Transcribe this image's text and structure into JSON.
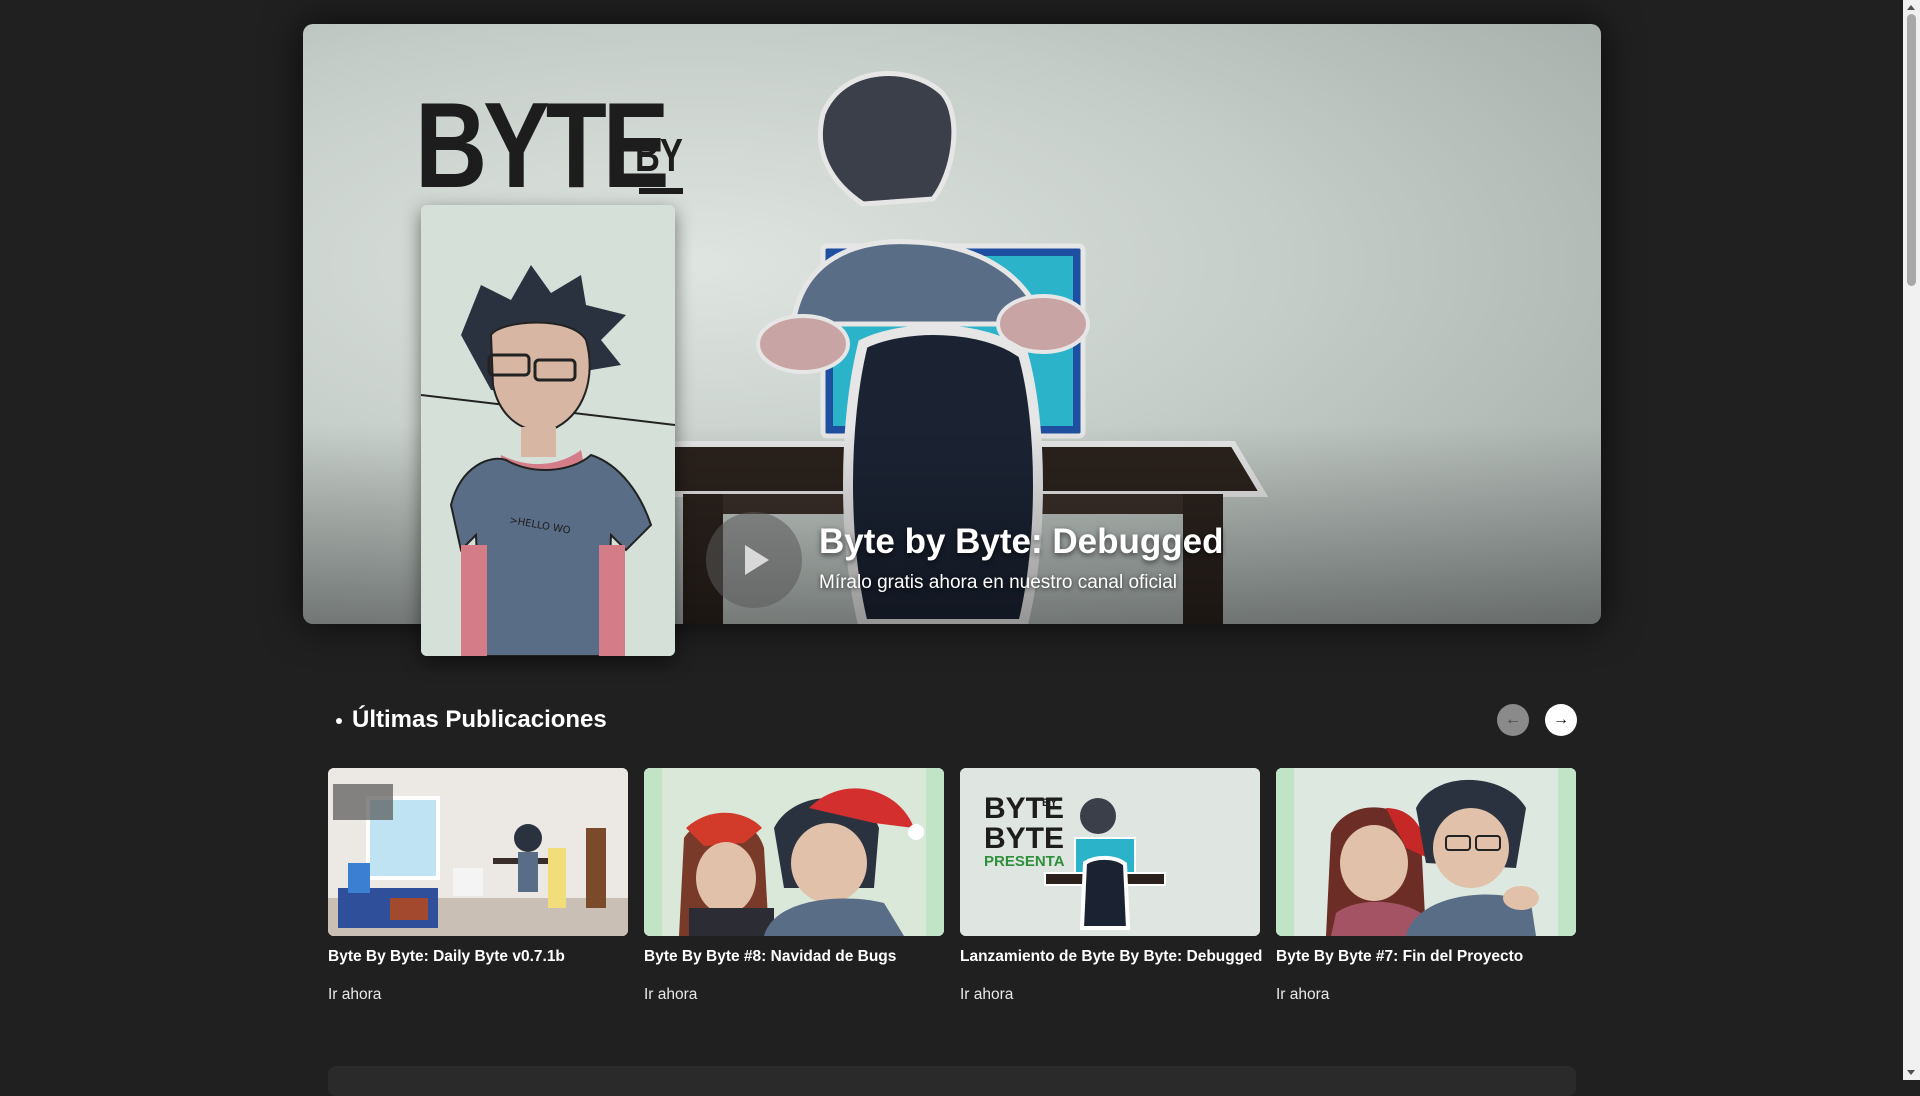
{
  "hero": {
    "logo_main": "BYTE",
    "logo_by": "BY",
    "title": "Byte by Byte: Debugged",
    "subtitle": "Míralo gratis ahora en nuestro canal oficial",
    "play_icon": "play-icon"
  },
  "latest": {
    "heading": "Últimas Publicaciones",
    "prev_icon": "arrow-left-icon",
    "next_icon": "arrow-right-icon",
    "cards": [
      {
        "title": "Byte By Byte: Daily Byte v0.7.1b",
        "link": "Ir ahora"
      },
      {
        "title": "Byte By Byte #8: Navidad de Bugs",
        "link": "Ir ahora"
      },
      {
        "title": "Lanzamiento de Byte By Byte: Debugged",
        "link": "Ir ahora",
        "thumb_logo_1": "BYTE",
        "thumb_logo_2": "BYTE",
        "thumb_by": "BY",
        "thumb_presenta": "PRESENTA"
      },
      {
        "title": "Byte By Byte #7: Fin del Proyecto",
        "link": "Ir ahora"
      }
    ]
  },
  "colors": {
    "background": "#202020",
    "text": "#ffffff",
    "poster_bg": "#d5e0d8"
  }
}
